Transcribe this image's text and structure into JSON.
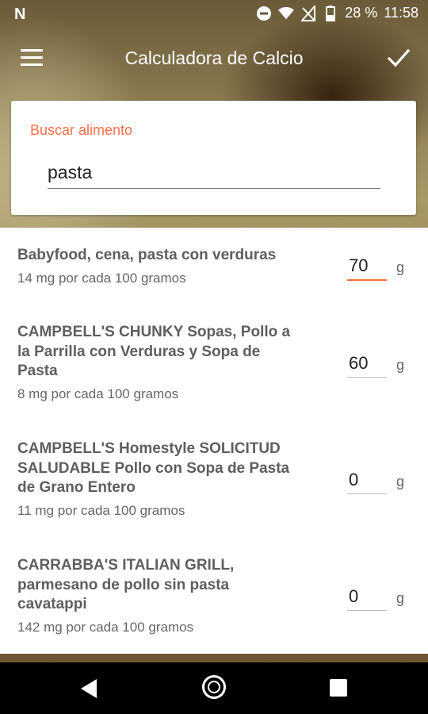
{
  "status": {
    "n_icon": "N",
    "battery": "28 %",
    "time": "11:58",
    "icons": [
      "do-not-disturb-icon",
      "wifi-icon",
      "no-signal-icon",
      "battery-icon"
    ]
  },
  "appbar": {
    "title": "Calculadora de Calcio",
    "menu_icon": "menu-icon",
    "confirm_icon": "check-icon"
  },
  "search": {
    "label": "Buscar alimento",
    "value": "pasta"
  },
  "items": [
    {
      "name": "Babyfood, cena, pasta con verduras",
      "sub": "14 mg por cada 100 gramos",
      "qty": "70",
      "unit": "g"
    },
    {
      "name": "CAMPBELL'S CHUNKY Sopas, Pollo a la Parrilla con Verduras y Sopa de Pasta",
      "sub": "8 mg por cada 100 gramos",
      "qty": "60",
      "unit": "g"
    },
    {
      "name": "CAMPBELL'S Homestyle SOLICITUD SALUDABLE Pollo con Sopa de Pasta de Grano Entero",
      "sub": "11 mg por cada 100 gramos",
      "qty": "0",
      "unit": "g"
    },
    {
      "name": "CARRABBA'S ITALIAN GRILL, parmesano de pollo sin pasta cavatappi",
      "sub": "142 mg por cada 100 gramos",
      "qty": "0",
      "unit": "g"
    }
  ],
  "colors": {
    "accent": "#ff6f4a",
    "text_primary": "#5e5e5e"
  }
}
